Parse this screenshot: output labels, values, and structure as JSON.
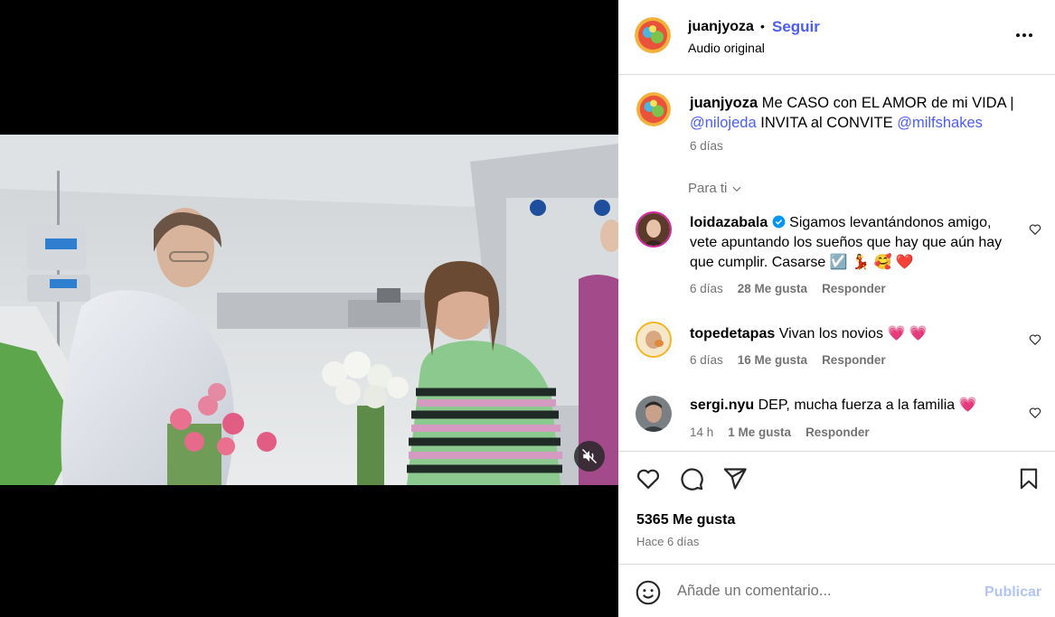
{
  "header": {
    "username": "juanjyoza",
    "separator": "•",
    "follow_label": "Seguir",
    "audio_label": "Audio original"
  },
  "caption": {
    "username": "juanjyoza",
    "text_1": "Me CASO con EL AMOR de mi VIDA |",
    "mention_1": "@nilojeda",
    "text_2": "INVITA al CONVITE",
    "mention_2": "@milfshakes",
    "time": "6 días"
  },
  "for_you_label": "Para ti",
  "comments": [
    {
      "username": "loidazabala",
      "verified": true,
      "text": "Sigamos levantándonos amigo, vete apuntando los sueños que hay que aún hay que cumplir. Casarse",
      "emojis": "☑️ 💃 🥰 ❤️",
      "time": "6 días",
      "likes": "28 Me gusta",
      "reply_label": "Responder"
    },
    {
      "username": "topedetapas",
      "verified": false,
      "text": "Vivan los novios",
      "emojis": "💗 💗",
      "time": "6 días",
      "likes": "16 Me gusta",
      "reply_label": "Responder"
    },
    {
      "username": "sergi.nyu",
      "verified": false,
      "text": "DEP, mucha fuerza a la familia",
      "emojis": "💗",
      "time": "14 h",
      "likes": "1 Me gusta",
      "reply_label": "Responder"
    }
  ],
  "actions": {
    "icons": [
      "heart-icon",
      "comment-icon",
      "share-icon",
      "bookmark-icon"
    ],
    "likes_count": "5365 Me gusta",
    "posted_ago": "Hace 6 días"
  },
  "composer": {
    "placeholder": "Añade un comentario...",
    "publish_label": "Publicar"
  },
  "colors": {
    "link": "#4a5df9",
    "muted": "#737373",
    "publish_disabled": "#b2c4f7",
    "heart_emoji": "#e3245b"
  }
}
